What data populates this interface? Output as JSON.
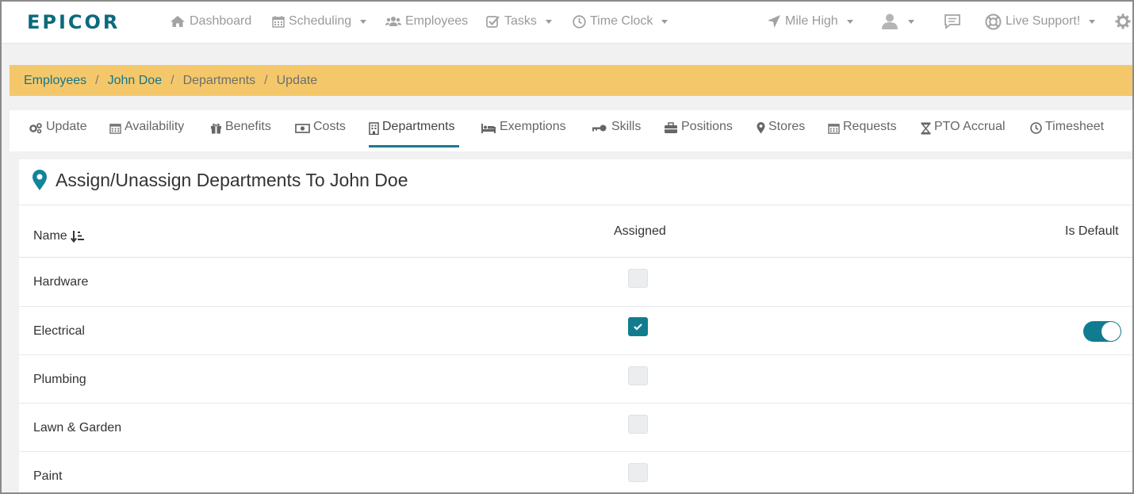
{
  "logo": "EPICOR",
  "nav": {
    "dashboard": "Dashboard",
    "scheduling": "Scheduling",
    "employees": "Employees",
    "tasks": "Tasks",
    "time_clock": "Time Clock",
    "location": "Mile High",
    "live_support": "Live Support!"
  },
  "breadcrumb": {
    "items": [
      "Employees",
      "John Doe",
      "Departments",
      "Update"
    ]
  },
  "tabs": [
    "Update",
    "Availability",
    "Benefits",
    "Costs",
    "Departments",
    "Exemptions",
    "Skills",
    "Positions",
    "Stores",
    "Requests",
    "PTO Accrual",
    "Timesheet"
  ],
  "active_tab": "Departments",
  "card": {
    "title": "Assign/Unassign Departments To John Doe",
    "columns": {
      "name": "Name",
      "assigned": "Assigned",
      "is_default": "Is Default"
    },
    "rows": [
      {
        "name": "Hardware",
        "assigned": false,
        "is_default": false
      },
      {
        "name": "Electrical",
        "assigned": true,
        "is_default": true
      },
      {
        "name": "Plumbing",
        "assigned": false,
        "is_default": false
      },
      {
        "name": "Lawn & Garden",
        "assigned": false,
        "is_default": false
      },
      {
        "name": "Paint",
        "assigned": false,
        "is_default": false
      }
    ]
  },
  "colors": {
    "brand": "#0b6b7c",
    "accent": "#117c90",
    "breadcrumb_bg": "#f4c86a"
  }
}
